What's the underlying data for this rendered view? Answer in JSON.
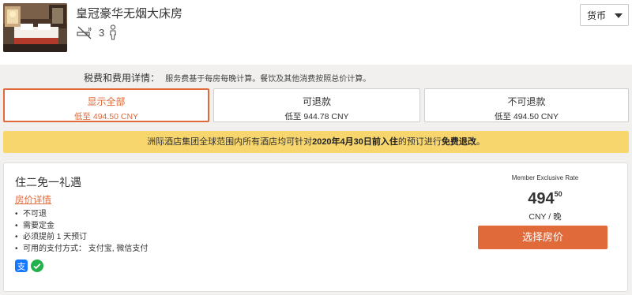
{
  "room": {
    "title": "皇冠豪华无烟大床房",
    "occupancy": "3",
    "icons": {
      "no_smoking": "no-smoking-icon",
      "person": "person-icon",
      "photo": "room-photo"
    }
  },
  "currency": {
    "label": "货币"
  },
  "fees": {
    "label": "税费和费用详情：",
    "text": "服务费基于每房每晚计算。餐饮及其他消费按照总价计算。"
  },
  "tabs": [
    {
      "label": "显示全部",
      "price": "低至 494.50 CNY",
      "active": true
    },
    {
      "label": "可退款",
      "price": "低至 944.78 CNY",
      "active": false
    },
    {
      "label": "不可退款",
      "price": "低至 494.50 CNY",
      "active": false
    }
  ],
  "banner": {
    "pre": "洲际酒店集团全球范围内所有酒店均可针对",
    "date": "2020年4月30日前入住",
    "mid": "的预订进行",
    "free": "免费退改",
    "end": "。"
  },
  "offer": {
    "title": "住二免一礼遇",
    "details_link": "房价详情",
    "policies": [
      "不可退",
      "需要定金",
      "必须提前 1 天预订",
      "可用的支付方式：  支付宝, 微信支付"
    ],
    "payment_icons": [
      "alipay-icon",
      "wechat-pay-icon"
    ],
    "rate_label": "Member Exclusive Rate",
    "price_int": "494",
    "price_dec": "50",
    "per_night": "CNY / 晚",
    "select_label": "选择房价"
  },
  "colors": {
    "accent": "#e06a3a",
    "banner": "#f8d66e",
    "page_bg": "#f1f0ef"
  }
}
